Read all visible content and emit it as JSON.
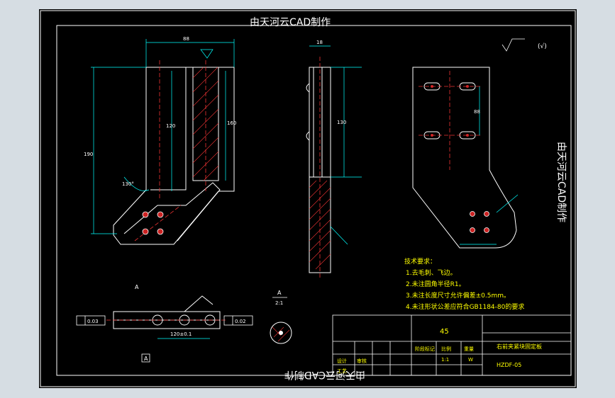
{
  "drawing": {
    "watermark_top": "由天河云CAD制作",
    "watermark_side": "由天河云CAD制作",
    "watermark_bottom": "由天河云CAD制作",
    "roughness_note": "(√)",
    "section_label": "A",
    "section_label_below": "2:1",
    "datum_label": "A",
    "view_label_arrow": "A"
  },
  "dims": {
    "front_width": "88",
    "front_height_total": "190",
    "front_height_slot": "120",
    "front_height_right": "160",
    "front_angle": "130°",
    "side_width": "18",
    "side_height": "130",
    "right_dim_vert": "88",
    "tol_left": "0.03",
    "tol_right": "0.02",
    "bottom_dim": "120±0.1"
  },
  "tech_requirements": {
    "title": "技术要求：",
    "items": [
      "1.去毛刺、飞边。",
      "2.未注圆角半径R1。",
      "3.未注长度尺寸允许偏差±0.5mm。",
      "4.未注形状公差应符合GB1184-80的要求"
    ]
  },
  "title_block": {
    "material": "45",
    "part_name": "右前夹紧块固定板",
    "drawing_no": "HZDF-05",
    "label_design": "设计",
    "label_check": "审核",
    "label_process": "工艺",
    "label_scale": "比例",
    "label_weight": "重量",
    "label_stage": "阶段标记",
    "scale_value": "1:1",
    "sheet_note": "W"
  }
}
